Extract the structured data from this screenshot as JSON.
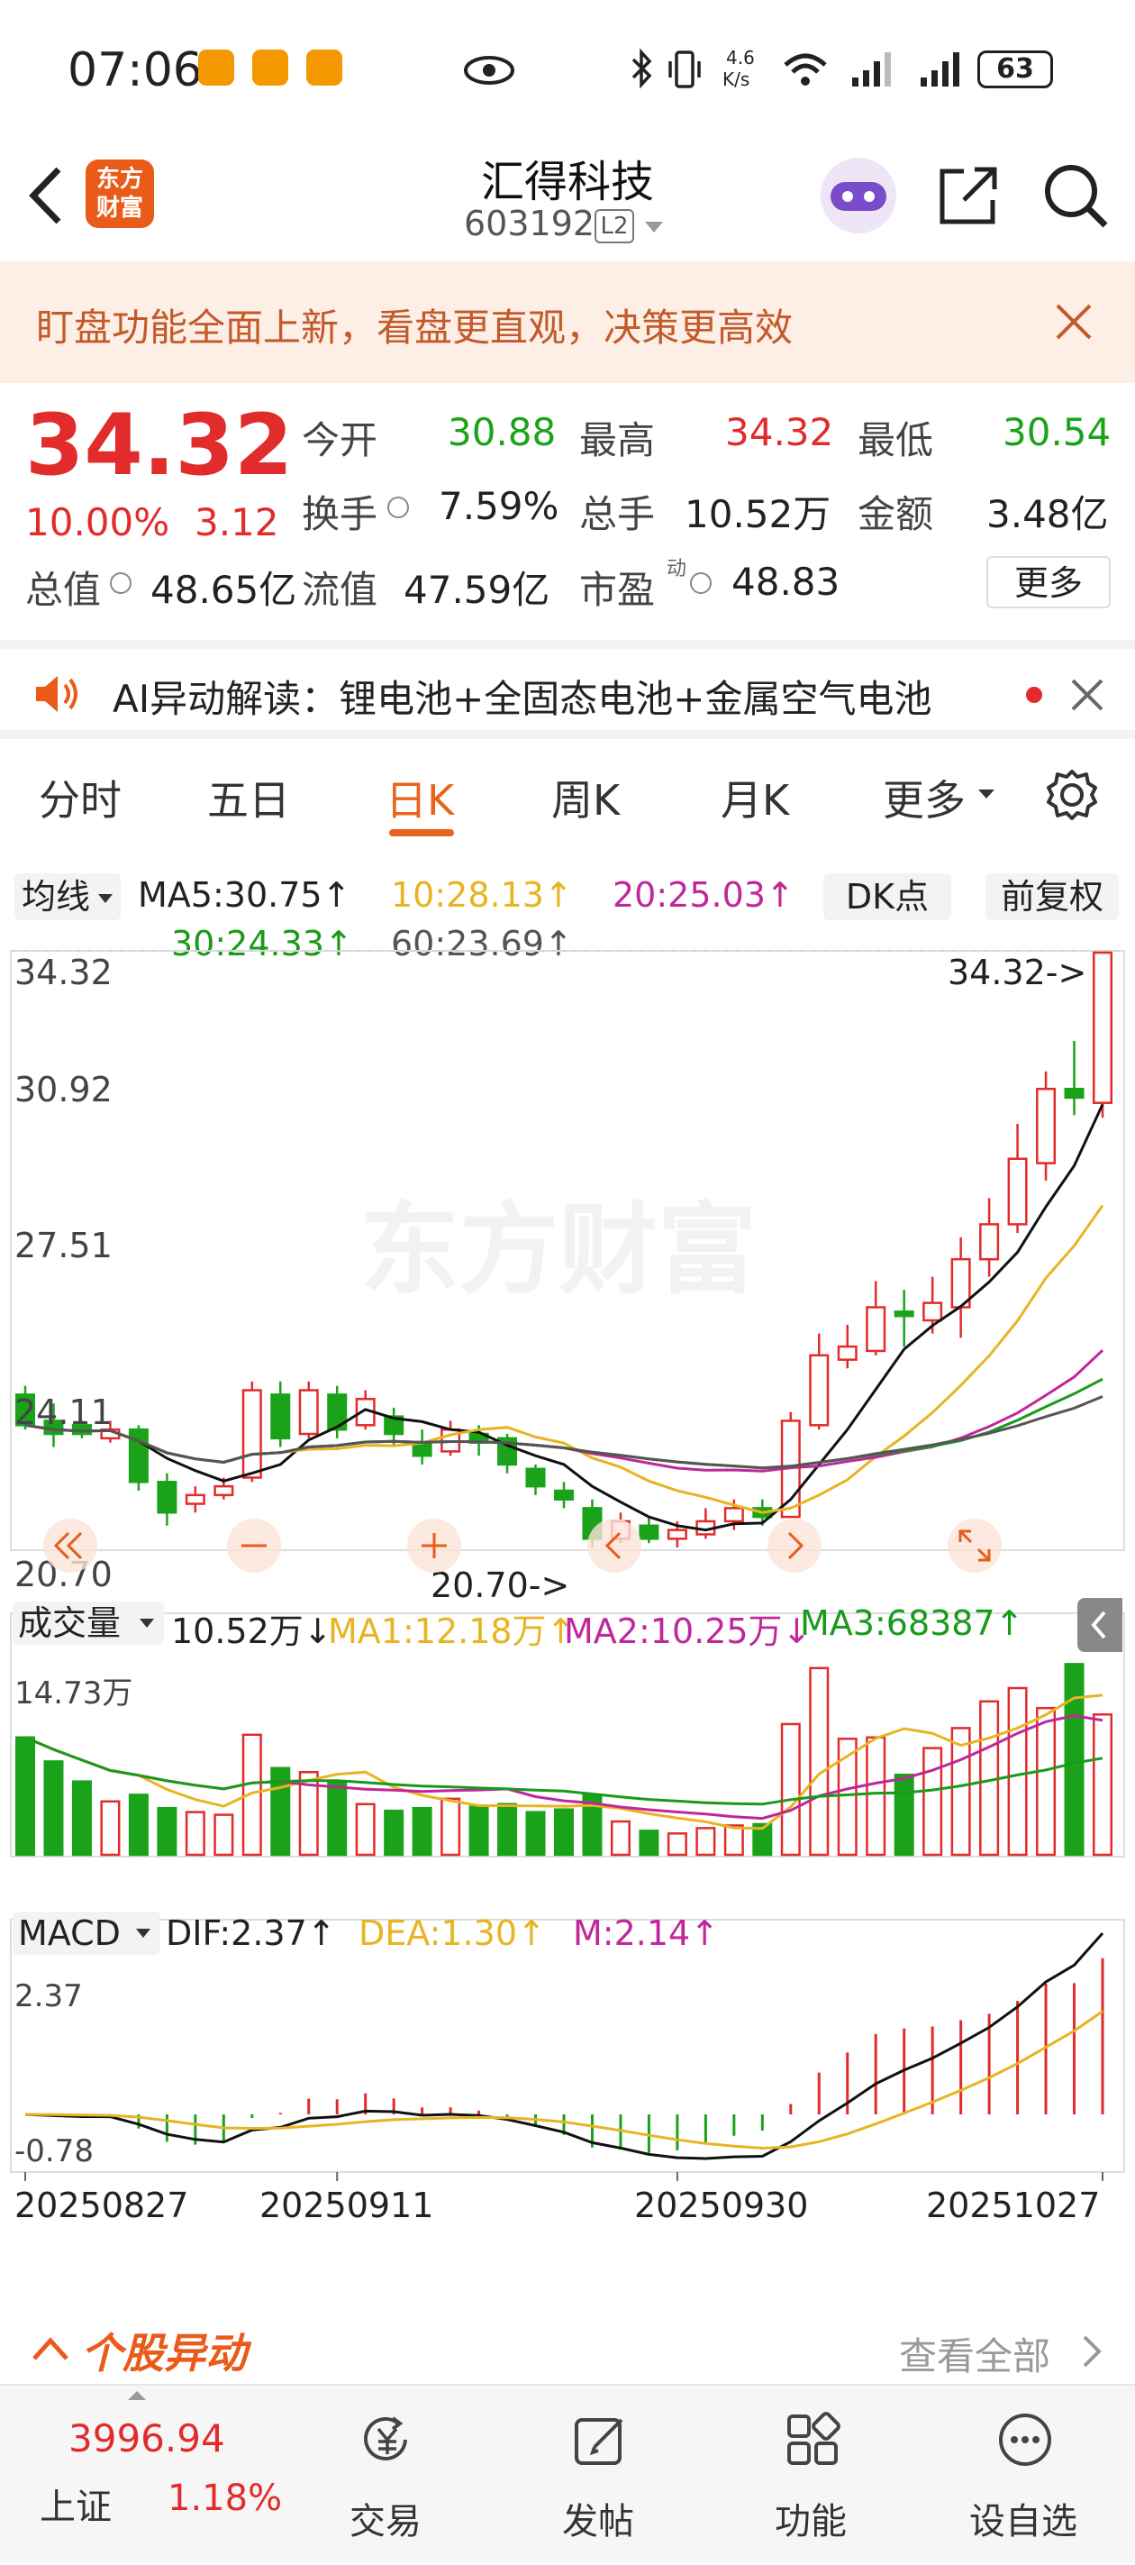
{
  "status_bar": {
    "time": "07:06",
    "net_speed_top": "4.6",
    "net_speed_bottom": "K/s",
    "battery": "63"
  },
  "header": {
    "name": "汇得科技",
    "code": "603192",
    "level": "L2",
    "logo_line1": "东方",
    "logo_line2": "财富"
  },
  "banner": {
    "text": "盯盘功能全面上新，看盘更直观，决策更高效"
  },
  "quote": {
    "price": "34.32",
    "change_pct": "10.00%",
    "change": "3.12",
    "open_label": "今开",
    "open": "30.88",
    "high_label": "最高",
    "high": "34.32",
    "low_label": "最低",
    "low": "30.54",
    "turnover_label": "换手",
    "turnover": "7.59%",
    "volume_label": "总手",
    "volume": "10.52万",
    "amount_label": "金额",
    "amount": "3.48亿",
    "mktcap_label": "总值",
    "mktcap": "48.65亿",
    "float_label": "流值",
    "float": "47.59亿",
    "pe_label": "市盈",
    "pe_sup": "动",
    "pe": "48.83",
    "more": "更多"
  },
  "ai": {
    "text": "AI异动解读：锂电池+全固态电池+金属空气电池"
  },
  "tabs": [
    "分时",
    "五日",
    "日K",
    "周K",
    "月K",
    "更多"
  ],
  "ma_legend": {
    "selector": "均线",
    "ma5": "MA5:30.75↑",
    "ma10": "10:28.13↑",
    "ma20": "20:25.03↑",
    "ma30": "30:24.33↑",
    "ma60": "60:23.69↑",
    "dk": "DK点",
    "fq": "前复权"
  },
  "price_axis": [
    "34.32",
    "30.92",
    "27.51",
    "24.11",
    "20.70"
  ],
  "price_marks": {
    "high_mark": "34.32->",
    "low_mark": "20.70->"
  },
  "watermark": "东方财富",
  "volume_legend": {
    "selector": "成交量",
    "vol": "10.52万↓",
    "ma1": "MA1:12.18万↑",
    "ma2": "MA2:10.25万↓",
    "ma3": "MA3:68387↑",
    "axis_max": "14.73万"
  },
  "macd_legend": {
    "selector": "MACD",
    "dif": "DIF:2.37↑",
    "dea": "DEA:1.30↑",
    "m": "M:2.14↑",
    "axis_max": "2.37",
    "axis_min": "-0.78"
  },
  "dates": [
    "20250827",
    "20250911",
    "20250930",
    "20251027"
  ],
  "section": {
    "title": "个股异动",
    "view_all": "查看全部"
  },
  "bottom_nav": {
    "index_value": "3996.94",
    "index_name": "上证",
    "index_change": "1.18%",
    "items": [
      "交易",
      "发帖",
      "功能",
      "设自选"
    ]
  },
  "colors": {
    "up": "#e22b2b",
    "down": "#1aa31a",
    "accent": "#e8641b",
    "ma5": "#111111",
    "ma10": "#e8b422",
    "ma20": "#c0279a",
    "ma30": "#1a9a1a",
    "ma60": "#555555"
  },
  "chart_data": {
    "type": "candlestick",
    "price_range": [
      20.7,
      34.32
    ],
    "volume_max": 147300,
    "macd_range": [
      -0.78,
      2.37
    ],
    "candles": [
      {
        "o": 24.2,
        "c": 23.5,
        "h": 24.4,
        "l": 23.4,
        "v": 88000
      },
      {
        "o": 23.6,
        "c": 23.3,
        "h": 24.0,
        "l": 23.0,
        "v": 70000
      },
      {
        "o": 23.5,
        "c": 23.3,
        "h": 23.6,
        "l": 23.2,
        "v": 55000
      },
      {
        "o": 23.2,
        "c": 23.4,
        "h": 23.6,
        "l": 23.1,
        "v": 40000
      },
      {
        "o": 23.4,
        "c": 22.2,
        "h": 23.5,
        "l": 22.0,
        "v": 45000
      },
      {
        "o": 22.2,
        "c": 21.5,
        "h": 22.4,
        "l": 21.2,
        "v": 35000
      },
      {
        "o": 21.7,
        "c": 21.9,
        "h": 22.1,
        "l": 21.5,
        "v": 32000
      },
      {
        "o": 21.9,
        "c": 22.1,
        "h": 22.3,
        "l": 21.8,
        "v": 30000
      },
      {
        "o": 22.3,
        "c": 24.3,
        "h": 24.5,
        "l": 22.2,
        "v": 90000
      },
      {
        "o": 24.2,
        "c": 23.2,
        "h": 24.5,
        "l": 23.0,
        "v": 65000
      },
      {
        "o": 23.3,
        "c": 24.3,
        "h": 24.5,
        "l": 23.2,
        "v": 62000
      },
      {
        "o": 24.2,
        "c": 23.4,
        "h": 24.4,
        "l": 23.2,
        "v": 55000
      },
      {
        "o": 23.5,
        "c": 24.1,
        "h": 24.3,
        "l": 23.4,
        "v": 38000
      },
      {
        "o": 23.7,
        "c": 23.3,
        "h": 23.9,
        "l": 23.0,
        "v": 33000
      },
      {
        "o": 23.1,
        "c": 22.8,
        "h": 23.4,
        "l": 22.6,
        "v": 35000
      },
      {
        "o": 22.9,
        "c": 23.4,
        "h": 23.6,
        "l": 22.8,
        "v": 42000
      },
      {
        "o": 23.3,
        "c": 23.1,
        "h": 23.5,
        "l": 22.8,
        "v": 36000
      },
      {
        "o": 23.2,
        "c": 22.6,
        "h": 23.3,
        "l": 22.4,
        "v": 38000
      },
      {
        "o": 22.5,
        "c": 22.1,
        "h": 22.6,
        "l": 21.9,
        "v": 32000
      },
      {
        "o": 22.0,
        "c": 21.8,
        "h": 22.2,
        "l": 21.6,
        "v": 34000
      },
      {
        "o": 21.6,
        "c": 20.9,
        "h": 21.8,
        "l": 20.7,
        "v": 45000
      },
      {
        "o": 20.9,
        "c": 21.3,
        "h": 21.5,
        "l": 20.8,
        "v": 25000
      },
      {
        "o": 21.2,
        "c": 20.9,
        "h": 21.4,
        "l": 20.8,
        "v": 18000
      },
      {
        "o": 20.9,
        "c": 21.1,
        "h": 21.3,
        "l": 20.7,
        "v": 16000
      },
      {
        "o": 21.0,
        "c": 21.3,
        "h": 21.6,
        "l": 20.9,
        "v": 20000
      },
      {
        "o": 21.3,
        "c": 21.6,
        "h": 21.8,
        "l": 21.1,
        "v": 22000
      },
      {
        "o": 21.6,
        "c": 21.4,
        "h": 21.8,
        "l": 21.2,
        "v": 23000
      },
      {
        "o": 21.4,
        "c": 23.6,
        "h": 23.8,
        "l": 21.4,
        "v": 98000
      },
      {
        "o": 23.5,
        "c": 25.1,
        "h": 25.6,
        "l": 23.4,
        "v": 140000
      },
      {
        "o": 25.0,
        "c": 25.3,
        "h": 25.8,
        "l": 24.8,
        "v": 87000
      },
      {
        "o": 25.2,
        "c": 26.2,
        "h": 26.8,
        "l": 25.1,
        "v": 88000
      },
      {
        "o": 26.1,
        "c": 26.0,
        "h": 26.6,
        "l": 25.3,
        "v": 60000
      },
      {
        "o": 25.9,
        "c": 26.3,
        "h": 26.9,
        "l": 25.6,
        "v": 80000
      },
      {
        "o": 26.2,
        "c": 27.3,
        "h": 27.8,
        "l": 25.5,
        "v": 95000
      },
      {
        "o": 27.3,
        "c": 28.1,
        "h": 28.7,
        "l": 26.9,
        "v": 115000
      },
      {
        "o": 28.1,
        "c": 29.6,
        "h": 30.4,
        "l": 27.9,
        "v": 125000
      },
      {
        "o": 29.5,
        "c": 31.2,
        "h": 31.6,
        "l": 29.1,
        "v": 110000
      },
      {
        "o": 31.2,
        "c": 31.0,
        "h": 32.3,
        "l": 30.6,
        "v": 143000
      },
      {
        "o": 30.88,
        "c": 34.32,
        "h": 34.32,
        "l": 30.54,
        "v": 105200
      }
    ]
  }
}
